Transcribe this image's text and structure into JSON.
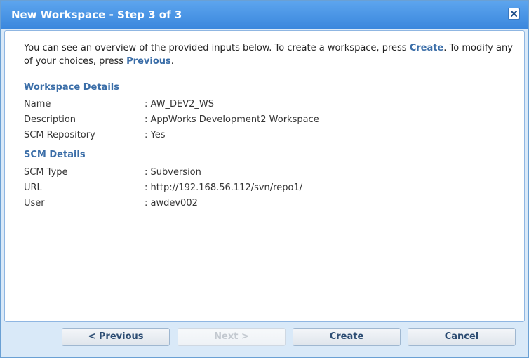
{
  "window": {
    "title": "New Workspace - Step 3 of 3"
  },
  "intro": {
    "part1": "You can see an overview of the provided inputs below. To create a workspace, press ",
    "create_word": "Create",
    "part2": ". To modify any of your choices, press ",
    "previous_word": "Previous",
    "part3": "."
  },
  "workspace_details": {
    "title": "Workspace Details",
    "rows": [
      {
        "label": "Name",
        "value": ": AW_DEV2_WS"
      },
      {
        "label": "Description",
        "value": ": AppWorks Development2 Workspace"
      },
      {
        "label": "SCM Repository",
        "value": ": Yes"
      }
    ]
  },
  "scm_details": {
    "title": "SCM Details",
    "rows": [
      {
        "label": "SCM Type",
        "value": ": Subversion"
      },
      {
        "label": "URL",
        "value": ": http://192.168.56.112/svn/repo1/"
      },
      {
        "label": "User",
        "value": ": awdev002"
      }
    ]
  },
  "buttons": {
    "previous": "< Previous",
    "next": "Next >",
    "create": "Create",
    "cancel": "Cancel"
  },
  "icons": {
    "close": "close-icon"
  },
  "colors": {
    "titlebar": "#3a87dd",
    "accent_text": "#3b6ea8",
    "window_bg": "#d9e9f8"
  }
}
